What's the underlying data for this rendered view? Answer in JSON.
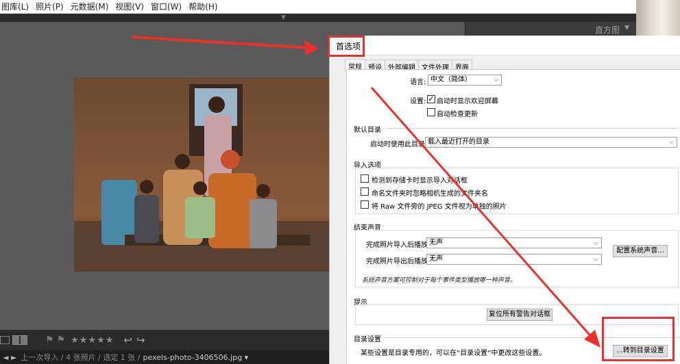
{
  "menubar": {
    "items": [
      "图库(L)",
      "照片(P)",
      "元数据(M)",
      "视图(V)",
      "窗口(W)",
      "帮助(H)"
    ]
  },
  "right_panel": {
    "histogram_label": "直方图",
    "histogram_arrow": "▼"
  },
  "toolbar": {
    "flags": "⚑⚑",
    "stars": "★★★★★",
    "rotate_left": "↩",
    "rotate_right": "↪"
  },
  "status": {
    "nav_arrows": "◄ ►",
    "source": "上一次导入 / 4 张照片 / 选定 1 张 /",
    "filename": "pexels-photo-3406506.jpg ▾"
  },
  "dialog": {
    "title": "首选项",
    "tabs": [
      "常规",
      "预设",
      "外部编辑",
      "文件处理",
      "界面"
    ],
    "language_label": "语言:",
    "language_value": "中文（简体）",
    "settings_label": "设置:",
    "settings_opt1": "启动时显示欢迎屏幕",
    "settings_opt2": "自动检查更新",
    "default_catalog_header": "默认目录",
    "startup_catalog_label": "启动时使用此目录:",
    "startup_catalog_value": "载入最近打开的目录",
    "import_header": "导入选项",
    "import_opt1": "检测到存储卡时显示导入对话框",
    "import_opt2": "命名文件夹时忽略相机生成的文件夹名",
    "import_opt3": "将 Raw 文件旁的 JPEG 文件视为单独的照片",
    "sound_header": "结束声音",
    "sound_import_label": "完成照片导入后播放:",
    "sound_import_value": "无声",
    "sound_export_label": "完成照片导出后播放:",
    "sound_export_value": "无声",
    "config_sound_button": "配置系统声音...",
    "sound_note": "系统声音方案可控制对于每个事件类型播放哪一种声音。",
    "tips_header": "提示",
    "reset_warnings_button": "复位所有警告对话框",
    "catalog_settings_header": "目录设置",
    "catalog_settings_text": "某些设置是目录专用的，可以在“目录设置”中更改这些设置。",
    "go_catalog_button": "...转到目录设置"
  },
  "colors": {
    "annotation_red": "#e8312a",
    "dialog_bg": "#f0f0f0",
    "lr_dark": "#2b2b2b"
  }
}
